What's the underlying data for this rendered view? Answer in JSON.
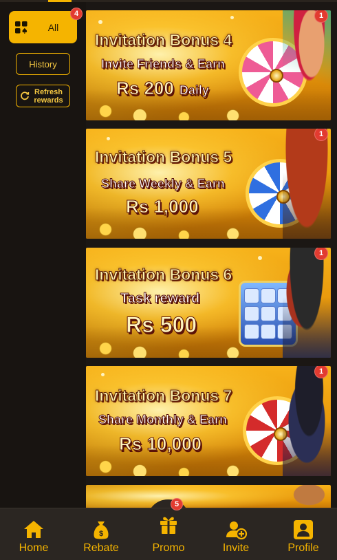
{
  "sidebar": {
    "all": {
      "label": "All",
      "badge": "4"
    },
    "history_label": "History",
    "refresh_label_1": "Refresh",
    "refresh_label_2": "rewards"
  },
  "banners": [
    {
      "title": "Invitation Bonus 4",
      "subtitle": "Invite Friends & Earn",
      "amount": "Rs 200",
      "suffix": "Daily",
      "badge": "1",
      "graphic": "pink-wheel-icon",
      "accent": "#e84a8a"
    },
    {
      "title": "Invitation Bonus 5",
      "subtitle": "Share Weekly & Earn",
      "amount": "Rs 1,000",
      "suffix": "",
      "badge": "1",
      "graphic": "blue-wheel-icon",
      "accent": "#2f6fe0"
    },
    {
      "title": "Invitation Bonus 6",
      "subtitle": "Task reward",
      "amount": "Rs 500",
      "suffix": "",
      "badge": "1",
      "graphic": "slot-machine-icon",
      "accent": "#3c7ae6"
    },
    {
      "title": "Invitation Bonus 7",
      "subtitle": "Share Monthly & Earn",
      "amount": "Rs 10,000",
      "suffix": "",
      "badge": "1",
      "graphic": "red-wheel-icon",
      "accent": "#d42b2b"
    }
  ],
  "nav": {
    "home": "Home",
    "rebate": "Rebate",
    "promo": "Promo",
    "promo_badge": "5",
    "invite": "Invite",
    "profile": "Profile"
  },
  "colors": {
    "accent": "#f5b400",
    "badge": "#e23b30",
    "background": "#1b1714",
    "nav_bg": "#2b2622"
  }
}
